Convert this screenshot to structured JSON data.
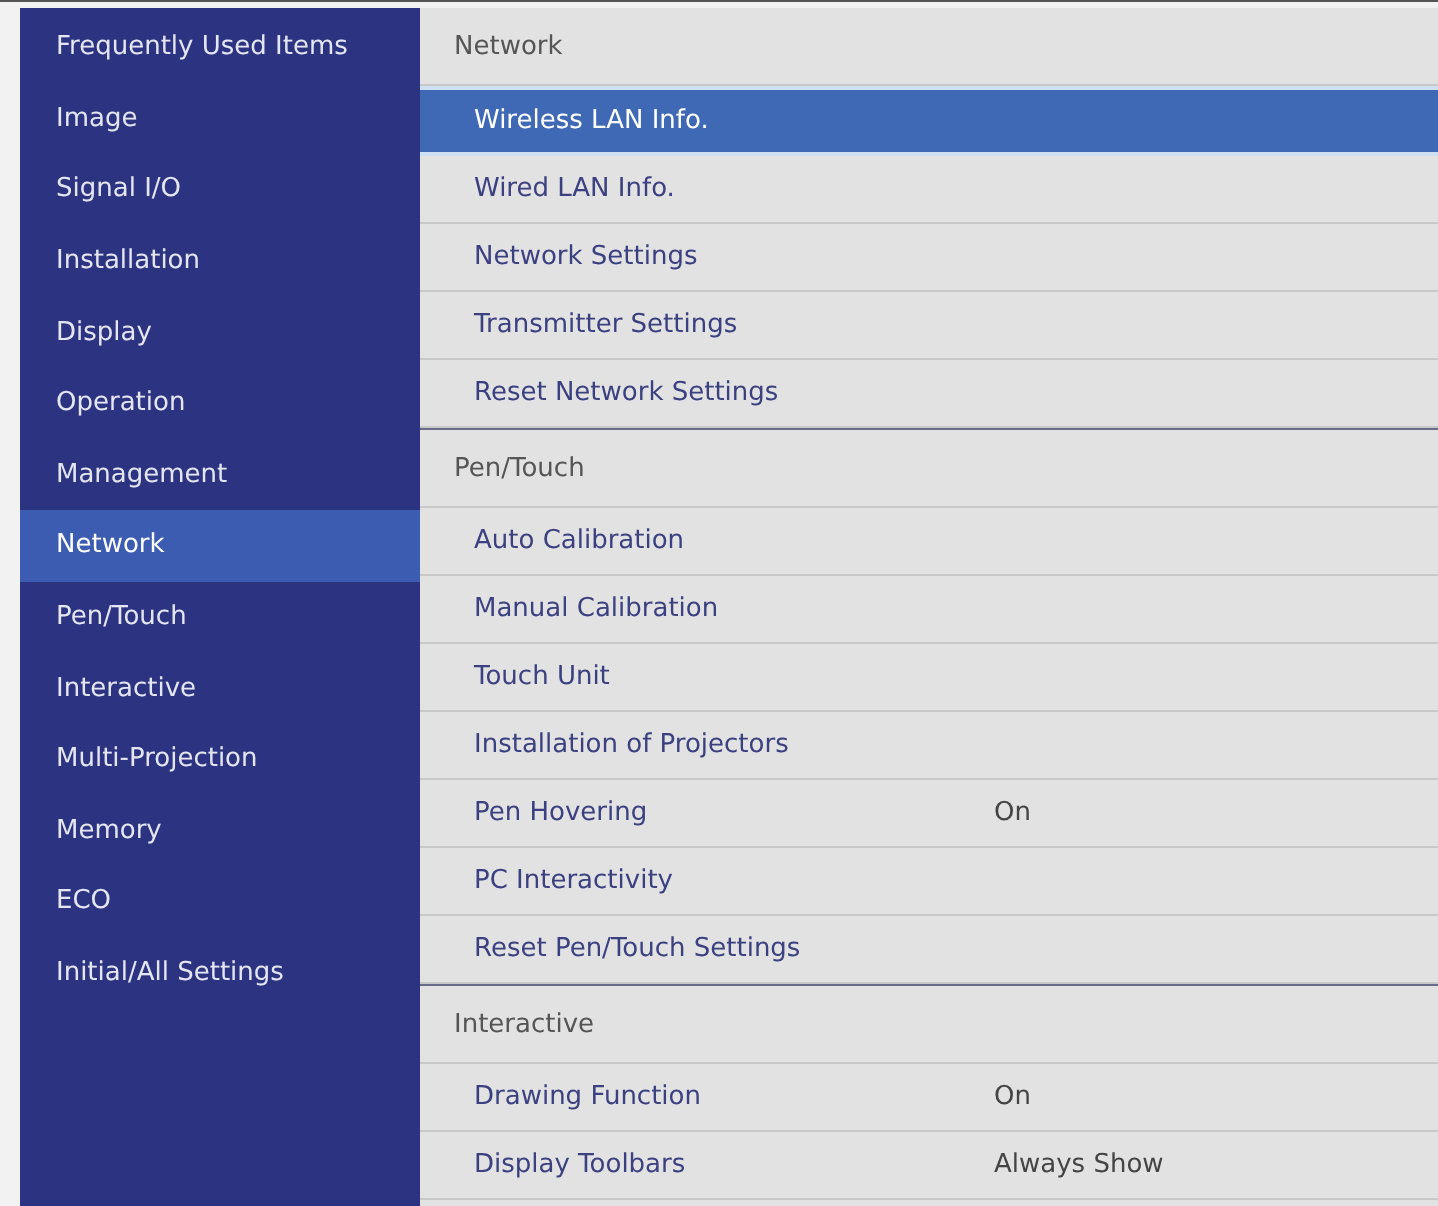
{
  "sidebar": {
    "items": [
      {
        "label": "Frequently Used Items",
        "selected": false
      },
      {
        "label": "Image",
        "selected": false
      },
      {
        "label": "Signal I/O",
        "selected": false
      },
      {
        "label": "Installation",
        "selected": false
      },
      {
        "label": "Display",
        "selected": false
      },
      {
        "label": "Operation",
        "selected": false
      },
      {
        "label": "Management",
        "selected": false
      },
      {
        "label": "Network",
        "selected": true
      },
      {
        "label": "Pen/Touch",
        "selected": false
      },
      {
        "label": "Interactive",
        "selected": false
      },
      {
        "label": "Multi-Projection",
        "selected": false
      },
      {
        "label": "Memory",
        "selected": false
      },
      {
        "label": "ECO",
        "selected": false
      },
      {
        "label": "Initial/All Settings",
        "selected": false
      }
    ]
  },
  "sections": [
    {
      "title": "Network",
      "items": [
        {
          "label": "Wireless LAN Info.",
          "selected": true
        },
        {
          "label": "Wired LAN Info.",
          "selected": false
        },
        {
          "label": "Network Settings",
          "selected": false
        },
        {
          "label": "Transmitter Settings",
          "selected": false
        },
        {
          "label": "Reset Network Settings",
          "selected": false
        }
      ]
    },
    {
      "title": "Pen/Touch",
      "items": [
        {
          "label": "Auto Calibration",
          "selected": false
        },
        {
          "label": "Manual Calibration",
          "selected": false
        },
        {
          "label": "Touch Unit",
          "selected": false
        },
        {
          "label": "Installation of Projectors",
          "selected": false
        },
        {
          "label": "Pen Hovering",
          "value": "On",
          "selected": false
        },
        {
          "label": "PC Interactivity",
          "selected": false
        },
        {
          "label": "Reset Pen/Touch Settings",
          "selected": false
        }
      ]
    },
    {
      "title": "Interactive",
      "items": [
        {
          "label": "Drawing Function",
          "value": "On",
          "selected": false
        },
        {
          "label": "Display Toolbars",
          "value": "Always Show",
          "selected": false
        }
      ]
    }
  ]
}
